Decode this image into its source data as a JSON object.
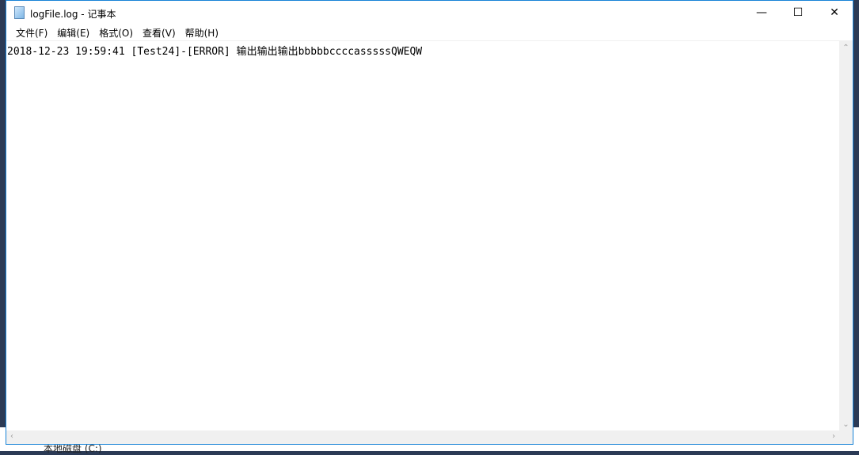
{
  "window": {
    "title": "logFile.log - 记事本"
  },
  "menu": [
    "文件(F)",
    "编辑(E)",
    "格式(O)",
    "查看(V)",
    "帮助(H)"
  ],
  "editor": {
    "content": "2018-12-23 19:59:41 [Test24]-[ERROR] 输出输出输出bbbbbccccasssssQWEQW"
  },
  "background": {
    "drive_label": "本地磁盘 (C:)"
  }
}
